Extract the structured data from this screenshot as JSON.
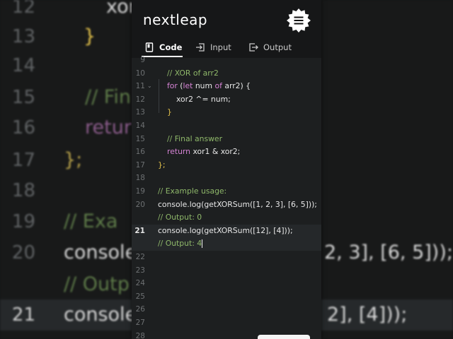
{
  "background": {
    "lines": [
      {
        "num": "12",
        "code": "xor"
      },
      {
        "num": "13",
        "code": "}"
      },
      {
        "num": "14",
        "code": ""
      },
      {
        "num": "15",
        "code": "// Fin"
      },
      {
        "num": "16",
        "code": "retur"
      },
      {
        "num": "17",
        "code": "};"
      },
      {
        "num": "18",
        "code": ""
      },
      {
        "num": "19",
        "code": "// Exa"
      },
      {
        "num": "20",
        "code": "console"
      },
      {
        "num": "",
        "code": "// Outp"
      },
      {
        "num": "21",
        "code": "console"
      }
    ],
    "right_fragments": {
      "line20": "2, 3], [6, 5]));",
      "line21": "2], [4]));"
    }
  },
  "header": {
    "logo": "nextleap",
    "menu_icon": "hamburger-badge-icon"
  },
  "tabs": [
    {
      "label": "Code",
      "icon": "file-icon",
      "active": true
    },
    {
      "label": "Input",
      "icon": "input-arrow-icon",
      "active": false
    },
    {
      "label": "Output",
      "icon": "output-arrow-icon",
      "active": false
    }
  ],
  "editor": {
    "lines": [
      {
        "num": "9",
        "code": ""
      },
      {
        "num": "10",
        "code": "// XOR of arr2"
      },
      {
        "num": "11",
        "code_kw1": "for",
        "code_a": " (",
        "code_kw2": "let",
        "code_b": " num ",
        "code_kw3": "of",
        "code_c": " arr2) {"
      },
      {
        "num": "12",
        "code": "xor2 ^= num;"
      },
      {
        "num": "13",
        "code": "}"
      },
      {
        "num": "14",
        "code": ""
      },
      {
        "num": "15",
        "code": "// Final answer"
      },
      {
        "num": "16",
        "code_kw": "return",
        "code_rest": " xor1 & xor2;"
      },
      {
        "num": "17",
        "code": "};"
      },
      {
        "num": "18",
        "code": ""
      },
      {
        "num": "19",
        "code": "// Example usage:"
      },
      {
        "num": "20",
        "code": "console.log(getXORSum([1, 2, 3], [6, 5]));"
      },
      {
        "num": "",
        "code": "// Output: 0"
      },
      {
        "num": "21",
        "code": "console.log(getXORSum([12], [4]));"
      },
      {
        "num": "",
        "code": "// Output: 4"
      },
      {
        "num": "22",
        "code": ""
      },
      {
        "num": "23",
        "code": ""
      },
      {
        "num": "24",
        "code": ""
      },
      {
        "num": "25",
        "code": ""
      },
      {
        "num": "26",
        "code": ""
      },
      {
        "num": "27",
        "code": ""
      },
      {
        "num": "28",
        "code": ""
      }
    ]
  },
  "colors": {
    "comment": "#8fb86a",
    "keyword": "#d583d4",
    "text": "#e8e8e8",
    "panel_bg": "#1d1f20",
    "header_bg": "#161718"
  }
}
